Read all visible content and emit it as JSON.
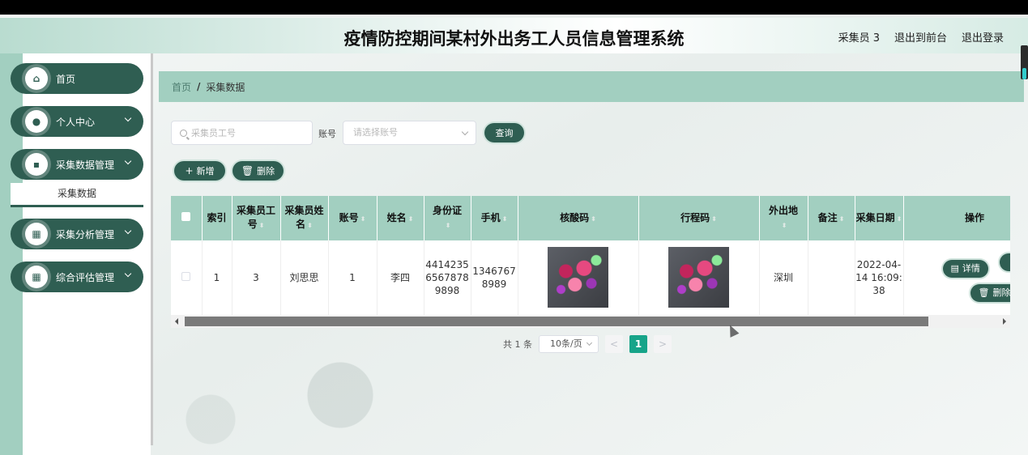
{
  "header": {
    "title": "疫情防控期间某村外出务工人员信息管理系统",
    "user_label": "采集员 3",
    "to_front_label": "退出到前台",
    "logout_label": "退出登录"
  },
  "sidebar": {
    "items": [
      {
        "label": "首页",
        "icon": "home-icon",
        "glyph": "⌂"
      },
      {
        "label": "个人中心",
        "icon": "user-icon",
        "glyph": "●"
      },
      {
        "label": "采集数据管理",
        "icon": "chat-icon",
        "glyph": "▪"
      },
      {
        "label": "采集分析管理",
        "icon": "grid-icon",
        "glyph": "▦"
      },
      {
        "label": "综合评估管理",
        "icon": "grid-icon",
        "glyph": "▦"
      }
    ],
    "submenu_label": "采集数据"
  },
  "breadcrumb": {
    "home": "首页",
    "separator": "/",
    "current": "采集数据"
  },
  "search": {
    "placeholder": "采集员工号",
    "account_label": "账号",
    "account_placeholder": "请选择账号",
    "query_label": "查询"
  },
  "actions": {
    "add_label": "新增",
    "delete_label": "删除",
    "add_glyph": "+",
    "delete_glyph": "🗑"
  },
  "table": {
    "headers": {
      "index": "索引",
      "collector_id": "采集员工号",
      "collector_name": "采集员姓名",
      "account": "账号",
      "name": "姓名",
      "id_card": "身份证",
      "phone": "手机",
      "nucleic_code": "核酸码",
      "travel_code": "行程码",
      "destination": "外出地",
      "remark": "备注",
      "collect_date": "采集日期",
      "operation": "操作"
    },
    "rows": [
      {
        "index": "1",
        "collector_id": "3",
        "collector_name": "刘思思",
        "account": "1",
        "name": "李四",
        "id_card": "441423565678789898",
        "phone": "13467678989",
        "destination": "深圳",
        "remark": "",
        "collect_date": "2022-04-14 16:09:38",
        "detail_label": "详情",
        "delete_label": "删除"
      }
    ]
  },
  "pagination": {
    "total_label": "共 1 条",
    "page_size_label": "10条/页",
    "current_page": "1",
    "prev": "<",
    "next": ">"
  }
}
